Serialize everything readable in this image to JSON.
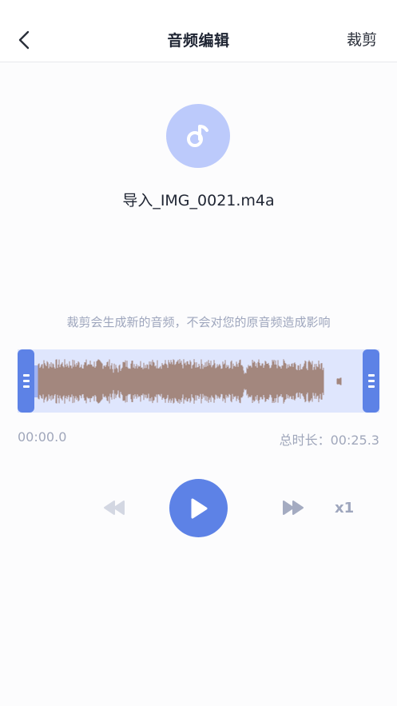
{
  "header": {
    "title": "音频编辑",
    "trim_label": "裁剪",
    "back_icon": "chevron-left-icon"
  },
  "file": {
    "icon": "music-note-icon",
    "name": "导入_IMG_0021.m4a"
  },
  "editor": {
    "hint": "裁剪会生成新的音频，不会对您的原音频造成影响",
    "time_start": "00:00.0",
    "time_total": "总时长：00:25.3"
  },
  "controls": {
    "rewind_icon": "rewind-icon",
    "play_icon": "play-icon",
    "forward_icon": "fast-forward-icon",
    "speed_label": "x1"
  },
  "colors": {
    "accent": "#5d82e6",
    "icon_bg": "#bccafb",
    "track_bg": "#dfe6fd",
    "waveform": "#a3877e",
    "muted_text": "#9ea6bd"
  }
}
